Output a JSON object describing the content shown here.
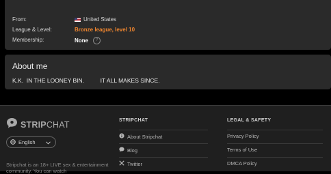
{
  "profile": {
    "from_label": "From:",
    "from_value": "United States",
    "league_label": "League & Level:",
    "league_value": "Bronze league, level 10",
    "membership_label": "Membership:",
    "membership_value": "None"
  },
  "about": {
    "title": "About me",
    "text": "K.K.  IN THE LOONEY BIN.          IT ALL MAKES SINCE."
  },
  "footer": {
    "brand_strong": "STRIP",
    "brand_light": "CHAT",
    "language": "English",
    "blurb": "Stripchat is an 18+ LIVE sex & entertainment community. You can watch",
    "col1_heading": "STRIPCHAT",
    "col1_items": [
      "About Stripchat",
      "Blog",
      "Twitter"
    ],
    "col2_heading": "LEGAL & SAFETY",
    "col2_items": [
      "Privacy Policy",
      "Terms of Use",
      "DMCA Policy"
    ]
  },
  "colors": {
    "league": "#f0862f",
    "panel": "#2a2a2a",
    "footer": "#1f1f1f"
  },
  "icons": {
    "flag": "us-flag-icon",
    "help": "question-circle-icon",
    "logo": "speech-bubble-logo-icon",
    "language": "globe-icon",
    "info": "info-circle-icon",
    "blog": "chat-bubble-icon",
    "twitter": "x-icon"
  }
}
